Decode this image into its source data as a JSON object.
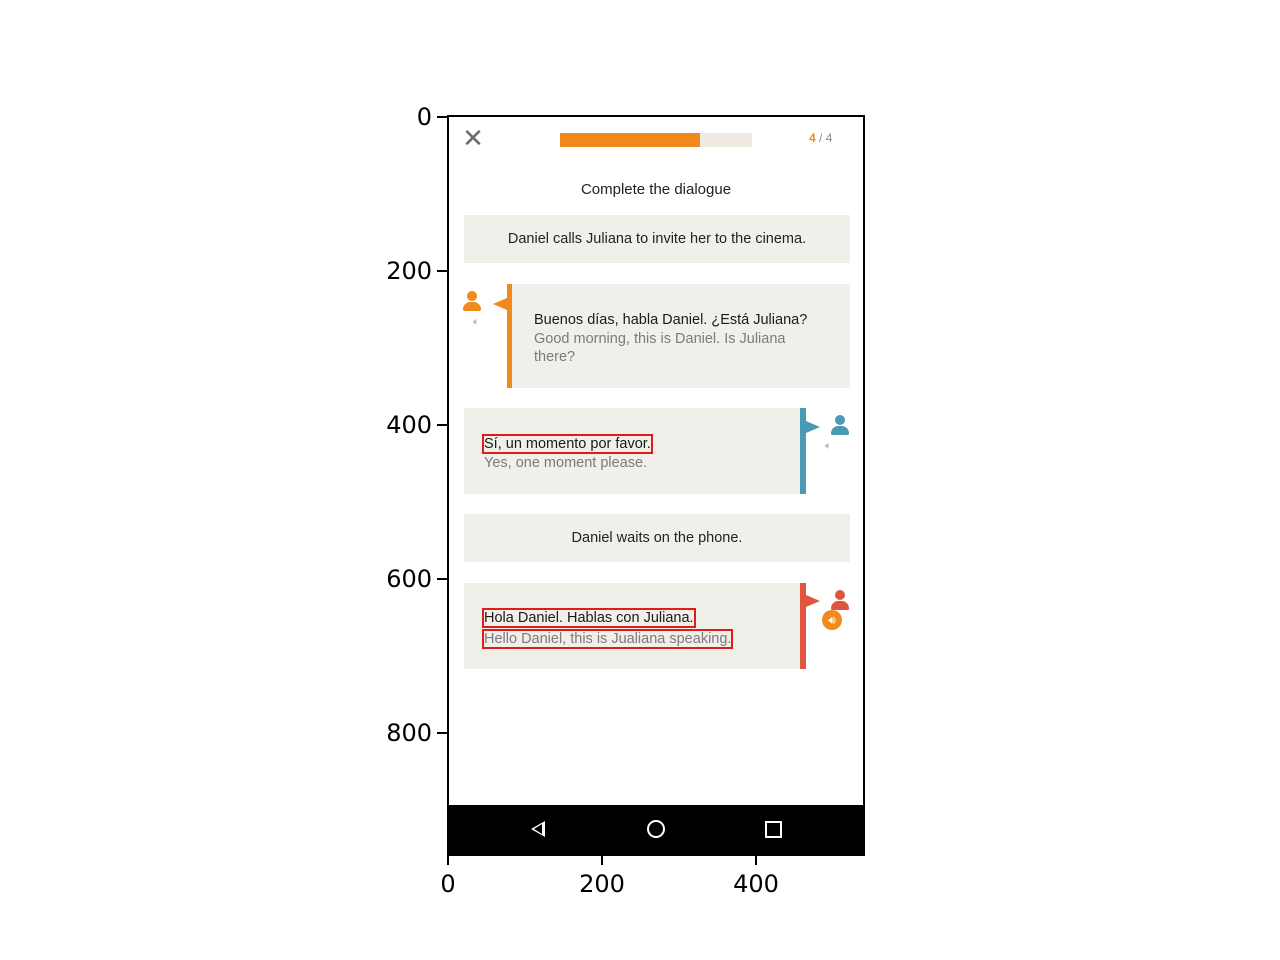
{
  "axes": {
    "y_ticks": [
      "0",
      "200",
      "400",
      "600",
      "800"
    ],
    "x_ticks": [
      "0",
      "200",
      "400"
    ]
  },
  "header": {
    "close_icon": "close-icon",
    "progress": {
      "current": "4",
      "separator": " / ",
      "total": "4",
      "fill_fraction": 0.73
    }
  },
  "exercise": {
    "instruction": "Complete the dialogue",
    "narration_1": "Daniel calls Juliana to invite her to the cinema.",
    "narration_2": "Daniel waits on the phone.",
    "dialogue": [
      {
        "speaker": "Daniel",
        "side": "left",
        "color": "#f08a1c",
        "es": "Buenos días, habla Daniel. ¿Está Juliana?",
        "en": "Good morning, this is Daniel. Is Juliana there?"
      },
      {
        "speaker": "other",
        "side": "right",
        "color": "#4a9ab3",
        "es": "Sí, un momento por favor.",
        "en": "Yes, one moment please."
      },
      {
        "speaker": "Juliana",
        "side": "right",
        "color": "#e0553d",
        "es": "Hola Daniel. Hablas con Juliana.",
        "en": "Hello Daniel, this is Jualiana speaking."
      }
    ]
  },
  "colors": {
    "accent": "#f08a1c",
    "card_bg": "#f1efe9",
    "highlight_box": "#e01b1b"
  },
  "navbar": {
    "back_icon": "back-triangle-icon",
    "home_icon": "home-circle-icon",
    "recent_icon": "recent-apps-square-icon"
  }
}
